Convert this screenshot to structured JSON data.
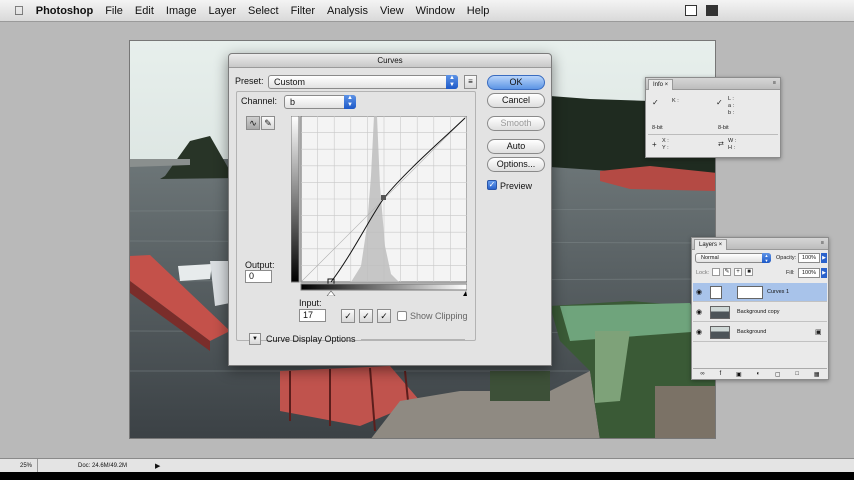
{
  "menubar": {
    "app": "Photoshop",
    "items": [
      "File",
      "Edit",
      "Image",
      "Layer",
      "Select",
      "Filter",
      "Analysis",
      "View",
      "Window",
      "Help"
    ]
  },
  "status": {
    "zoom": "25%",
    "doc": "Doc: 24.6M/49.2M"
  },
  "curves": {
    "title": "Curves",
    "preset_label": "Preset:",
    "preset_value": "Custom",
    "channel_label": "Channel:",
    "channel_value": "b",
    "output_label": "Output:",
    "output_value": "0",
    "input_label": "Input:",
    "input_value": "17",
    "show_clipping": "Show Clipping",
    "display_options": "Curve Display Options",
    "buttons": {
      "ok": "OK",
      "cancel": "Cancel",
      "smooth": "Smooth",
      "auto": "Auto",
      "options": "Options...",
      "preview": "Preview"
    }
  },
  "info_panel": {
    "tab": "Info",
    "k_label": "K :",
    "l_label": "L :",
    "a_label": "a :",
    "b_label": "b :",
    "bit1": "8-bit",
    "bit2": "8-bit",
    "x_label": "X :",
    "y_label": "Y :",
    "w_label": "W :",
    "h_label": "H :"
  },
  "layers_panel": {
    "tab": "Layers",
    "blend_mode": "Normal",
    "opacity_label": "Opacity:",
    "opacity_value": "100%",
    "lock_label": "Lock:",
    "fill_label": "Fill:",
    "fill_value": "100%",
    "layers": [
      {
        "name": "Curves 1"
      },
      {
        "name": "Background copy"
      },
      {
        "name": "Background"
      }
    ]
  },
  "colors": {
    "accent": "#2a62cc",
    "sky": "#cfd8d6",
    "water": "#4d5458",
    "dock": "#c4514a"
  }
}
